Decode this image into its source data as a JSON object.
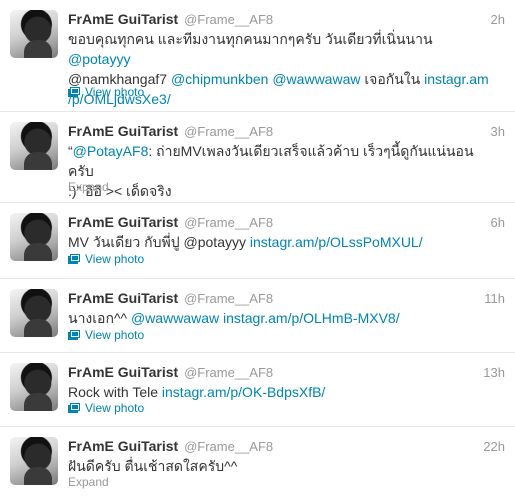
{
  "tweets": [
    {
      "name": "FrAmE GuiTarist",
      "username": "@Frame__AF8",
      "time": "2h",
      "line1_a": "ขอบคุณทุกคน และทีมงานทุกคนมากๆครับ วันเดียวที่เนิ่นนาน ",
      "line1_link": "@potayyy",
      "line2_link1": "@namkhangaf7",
      "line2_sp1": " ",
      "line2_link2": "@chipmunkben",
      "line2_sp2": " ",
      "line2_link3": "@wawwawaw",
      "line2_text": " เจอกันใน ",
      "line2_link4": "instagr.am",
      "line3_link": "/p/OMLjdwsXe3/",
      "action": "View photo"
    },
    {
      "name": "FrAmE GuiTarist",
      "username": "@Frame__AF8",
      "time": "3h",
      "line1_q": "“",
      "line1_link": "@PotayAF8",
      "line1_text": ": ถ่ายMVเพลงวันเดียวเสร็จแล้วค้าบ เร็วๆนี้ดูกันแน่นอนครับ",
      "line2_text": ":)” อิอิ >< เด็ดจริง",
      "action": "Expand"
    },
    {
      "name": "FrAmE GuiTarist",
      "username": "@Frame__AF8",
      "time": "6h",
      "text": "MV วันเดียว กับพี่ปู @potayyy ",
      "link": "instagr.am/p/OLssPoMXUL/",
      "action": "View photo"
    },
    {
      "name": "FrAmE GuiTarist",
      "username": "@Frame__AF8",
      "time": "11h",
      "text": "นางเอก^^ ",
      "link1": "@wawwawaw",
      "sp": " ",
      "link2": "instagr.am/p/OLHmB-MXV8/",
      "action": "View photo"
    },
    {
      "name": "FrAmE GuiTarist",
      "username": "@Frame__AF8",
      "time": "13h",
      "text": "Rock with Tele ",
      "link": "instagr.am/p/OK-BdpsXfB/",
      "action": "View photo"
    },
    {
      "name": "FrAmE GuiTarist",
      "username": "@Frame__AF8",
      "time": "22h",
      "text": "ฝันดีครับ ตื่นเช้าสดใสครับ^^",
      "action": "Expand"
    }
  ],
  "colors": {
    "link": "#0084b4",
    "muted": "#999999",
    "text": "#333333"
  },
  "icons": {
    "photo": "photo-icon"
  }
}
